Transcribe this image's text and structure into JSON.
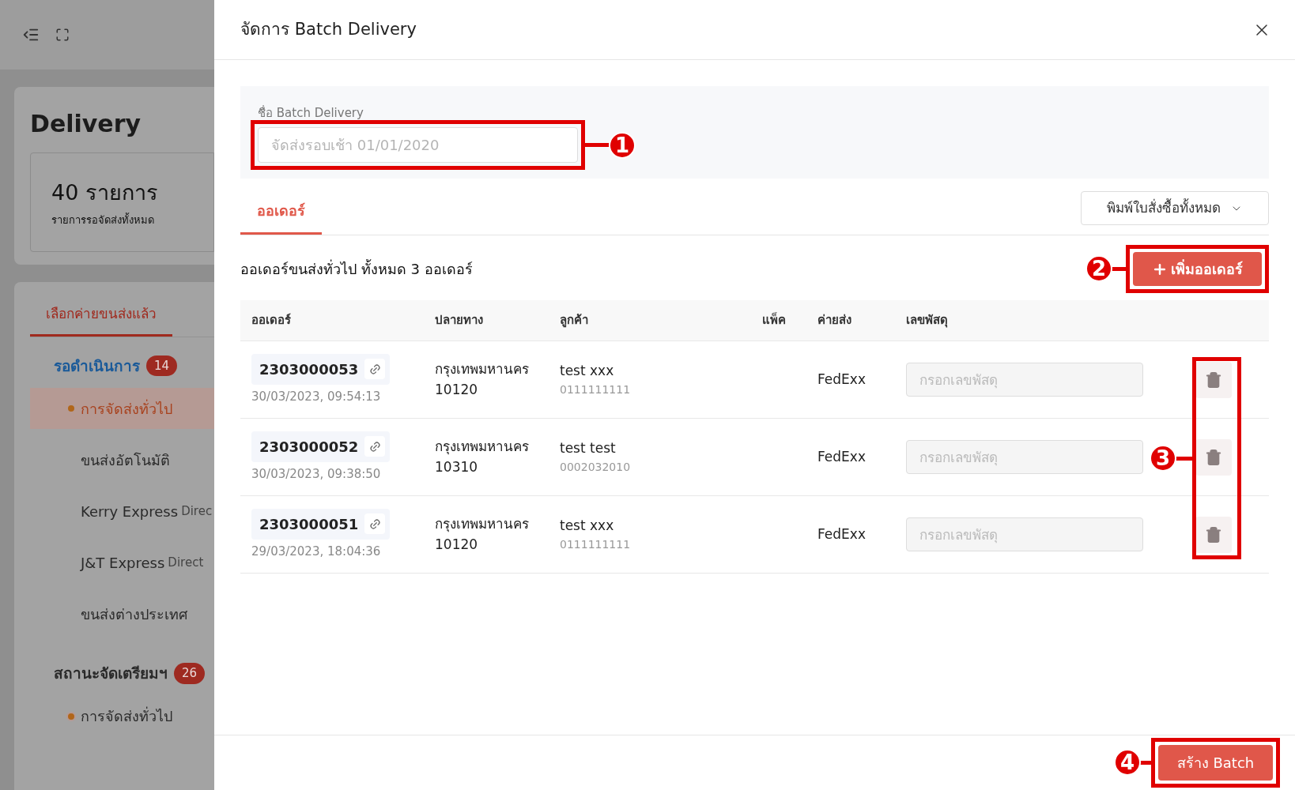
{
  "background": {
    "page_title": "Delivery",
    "summary": {
      "count": "40 รายการ",
      "caption": "รายการรอจัดส่งทั้งหมด"
    },
    "tabs": [
      {
        "label": "เลือกค่ายขนส่งแล้ว",
        "selected": true
      }
    ],
    "groups": [
      {
        "label": "รอดำเนินการ",
        "badge": "14",
        "selected": true,
        "items": [
          {
            "label": "การจัดส่งทั่วไป",
            "dot": true,
            "selected": true
          },
          {
            "label": "ขนส่งอัตโนมัติ",
            "dot": false,
            "selected": false
          },
          {
            "label": "Kerry Express",
            "suffix": "Direc",
            "dot": false,
            "selected": false
          },
          {
            "label": "J&T Express",
            "suffix": "Direct",
            "dot": false,
            "selected": false
          },
          {
            "label": "ขนส่งต่างประเทศ",
            "dot": false,
            "selected": false
          }
        ]
      },
      {
        "label": "สถานะจัดเตรียมฯ",
        "badge": "26",
        "selected": false,
        "items": [
          {
            "label": "การจัดส่งทั่วไป",
            "dot": true,
            "selected": false
          }
        ]
      }
    ]
  },
  "drawer": {
    "title": "จัดการ Batch Delivery",
    "form": {
      "label": "ชื่อ Batch Delivery",
      "placeholder": "จัดส่งรอบเช้า 01/01/2020"
    },
    "tabs": [
      {
        "label": "ออเดอร์",
        "selected": true
      }
    ],
    "print_dropdown": "พิมพ์ใบสั่งซื้อทั้งหมด",
    "summary": "ออเดอร์ขนส่งทั่วไป ทั้งหมด 3 ออเดอร์",
    "add_button": "เพิ่มออเดอร์",
    "table": {
      "columns": [
        "ออเดอร์",
        "ปลายทาง",
        "ลูกค้า",
        "แพ็ค",
        "ค่ายส่ง",
        "เลขพัสดุ"
      ],
      "rows": [
        {
          "order_no": "2303000053",
          "datetime": "30/03/2023, 09:54:13",
          "destination": [
            "กรุงเทพมหานคร",
            "10120"
          ],
          "customer": "test xxx",
          "phone": "0111111111",
          "carrier": "FedExx",
          "tracking_placeholder": "กรอกเลขพัสดุ"
        },
        {
          "order_no": "2303000052",
          "datetime": "30/03/2023, 09:38:50",
          "destination": [
            "กรุงเทพมหานคร",
            "10310"
          ],
          "customer": "test test",
          "phone": "0002032010",
          "carrier": "FedExx",
          "tracking_placeholder": "กรอกเลขพัสดุ"
        },
        {
          "order_no": "2303000051",
          "datetime": "29/03/2023, 18:04:36",
          "destination": [
            "กรุงเทพมหานคร",
            "10120"
          ],
          "customer": "test xxx",
          "phone": "0111111111",
          "carrier": "FedExx",
          "tracking_placeholder": "กรอกเลขพัสดุ"
        }
      ]
    },
    "create_button": "สร้าง Batch"
  },
  "annotations": [
    "1",
    "2",
    "3",
    "4"
  ]
}
